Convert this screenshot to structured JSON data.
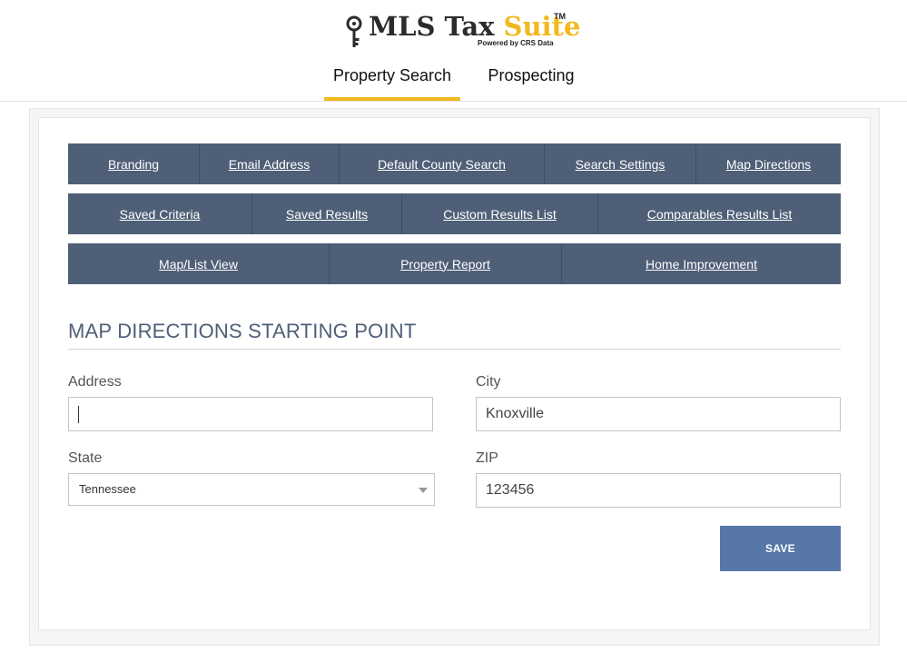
{
  "brand": {
    "name_main": "MLS Tax ",
    "name_accent": "Suite",
    "trademark": "TM",
    "powered_by": "Powered by CRS Data",
    "accent_color": "#f2b81f",
    "icon": "key-icon"
  },
  "nav": {
    "tabs": [
      {
        "label": "Property Search",
        "active": true
      },
      {
        "label": "Prospecting",
        "active": false
      }
    ]
  },
  "settings_menu": {
    "row1": [
      "Branding",
      "Email Address",
      "Default County Search",
      "Search Settings",
      "Map Directions"
    ],
    "row2": [
      "Saved Criteria",
      "Saved Results",
      "Custom Results List",
      "Comparables Results List"
    ],
    "row3": [
      "Map/List View",
      "Property Report",
      "Home Improvement"
    ],
    "button_color": "#4e5f77"
  },
  "form": {
    "title": "MAP DIRECTIONS STARTING POINT",
    "address": {
      "label": "Address",
      "value": ""
    },
    "city": {
      "label": "City",
      "value": "Knoxville"
    },
    "state": {
      "label": "State",
      "selected": "Tennessee"
    },
    "zip": {
      "label": "ZIP",
      "value": "123456"
    },
    "save_label": "SAVE",
    "save_color": "#5677a8"
  }
}
